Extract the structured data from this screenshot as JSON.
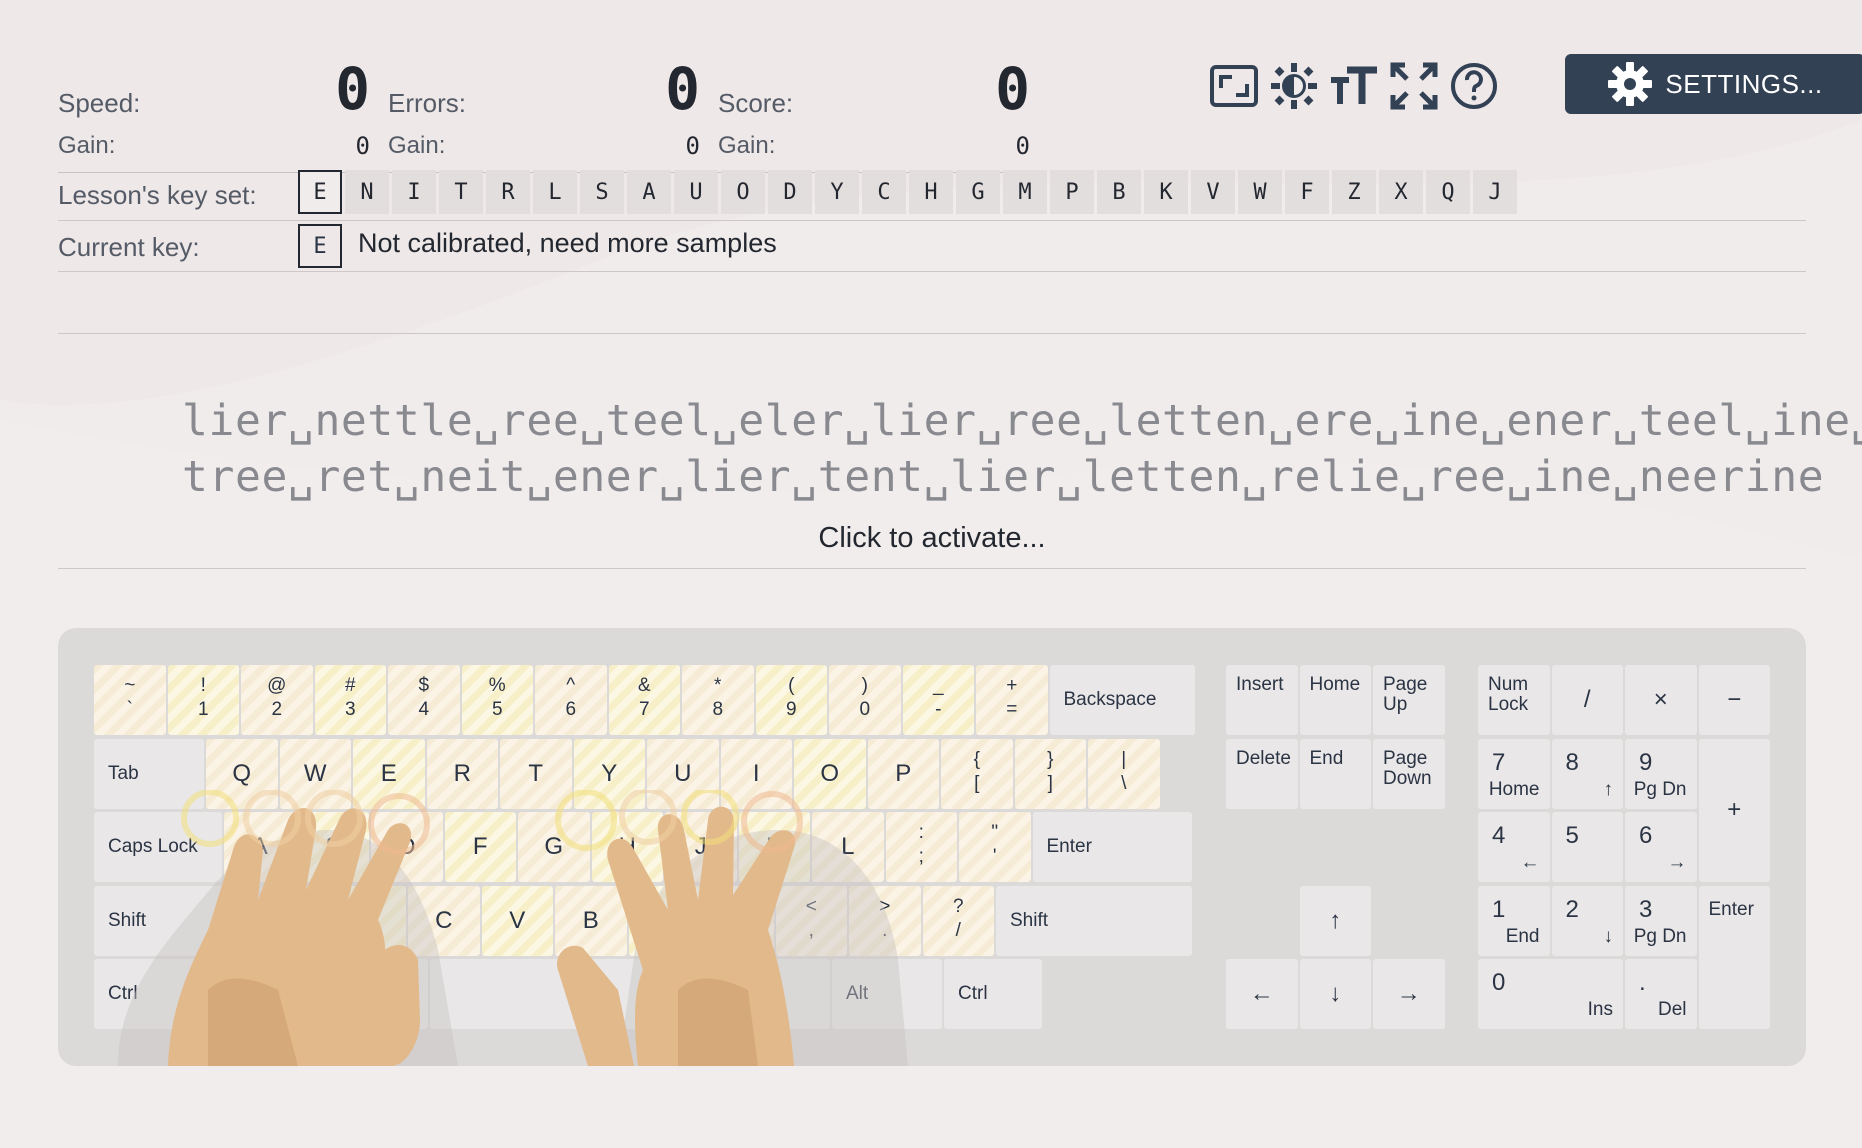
{
  "stats": {
    "speed_label": "Speed:",
    "speed_value": "0",
    "errors_label": "Errors:",
    "errors_value": "0",
    "score_label": "Score:",
    "score_value": "0",
    "gain_label": "Gain:",
    "speed_gain": "0",
    "errors_gain": "0",
    "score_gain": "0"
  },
  "toolbar": {
    "icons": [
      "fullscreen-window-icon",
      "theme-contrast-icon",
      "font-size-icon",
      "expand-icon",
      "help-icon",
      "gear-icon"
    ],
    "settings_label": "SETTINGS..."
  },
  "lesson": {
    "keyset_label": "Lesson's key set:",
    "keys": [
      "E",
      "N",
      "I",
      "T",
      "R",
      "L",
      "S",
      "A",
      "U",
      "O",
      "D",
      "Y",
      "C",
      "H",
      "G",
      "M",
      "P",
      "B",
      "K",
      "V",
      "W",
      "F",
      "Z",
      "X",
      "Q",
      "J"
    ],
    "current_label": "Current key:",
    "current_key": "E",
    "current_message": "Not calibrated, need more samples"
  },
  "text": {
    "line1": "lier␣nettle␣ree␣teel␣eler␣lier␣ree␣letten␣ere␣ine␣ener␣teel␣ine␣",
    "line2": "tree␣ret␣neit␣ener␣lier␣tent␣lier␣letten␣relie␣ree␣ine␣neerine",
    "activate": "Click to activate..."
  },
  "keyboard": {
    "row1": [
      [
        "~",
        "`"
      ],
      [
        "!",
        "1"
      ],
      [
        "@",
        "2"
      ],
      [
        "#",
        "3"
      ],
      [
        "$",
        "4"
      ],
      [
        "%",
        "5"
      ],
      [
        "^",
        "6"
      ],
      [
        "&",
        "7"
      ],
      [
        "*",
        "8"
      ],
      [
        "(",
        "9"
      ],
      [
        ")",
        "0"
      ],
      [
        "_",
        "-"
      ],
      [
        "+",
        "="
      ]
    ],
    "backspace": "Backspace",
    "tab": "Tab",
    "row2": [
      "Q",
      "W",
      "E",
      "R",
      "T",
      "Y",
      "U",
      "I",
      "O",
      "P"
    ],
    "row2_sym": [
      [
        "{",
        "["
      ],
      [
        "}",
        "]"
      ],
      [
        "|",
        "\\"
      ]
    ],
    "caps": "Caps Lock",
    "row3": [
      "A",
      "S",
      "D",
      "F",
      "G",
      "H",
      "J",
      "K",
      "L"
    ],
    "row3_sym": [
      [
        ":",
        ";"
      ],
      [
        "\"",
        "'"
      ]
    ],
    "enter": "Enter",
    "shift": "Shift",
    "row4": [
      "Z",
      "X",
      "C",
      "V",
      "B",
      "N",
      "M"
    ],
    "row4_sym": [
      [
        "<",
        ","
      ],
      [
        ">",
        "."
      ],
      [
        "?",
        "/"
      ]
    ],
    "ctrl": "Ctrl",
    "alt": "Alt",
    "nav": {
      "insert": "Insert",
      "home": "Home",
      "pageup": "Page Up",
      "delete": "Delete",
      "end": "End",
      "pagedown": "Page Down",
      "up": "↑",
      "left": "←",
      "down": "↓",
      "right": "→"
    },
    "numpad": {
      "numlock": "Num Lock",
      "div": "/",
      "mul": "×",
      "minus": "−",
      "plus": "+",
      "enter": "Enter",
      "n7": "7",
      "n7s": "Home",
      "n8": "8",
      "n8s": "↑",
      "n9": "9",
      "n9s": "Pg Dn",
      "n4": "4",
      "n4s": "←",
      "n5": "5",
      "n6": "6",
      "n6s": "→",
      "n1": "1",
      "n1s": "End",
      "n2": "2",
      "n2s": "↓",
      "n3": "3",
      "n3s": "Pg Dn",
      "n0": "0",
      "n0s": "Ins",
      "dot": ".",
      "dots": "Del"
    }
  }
}
